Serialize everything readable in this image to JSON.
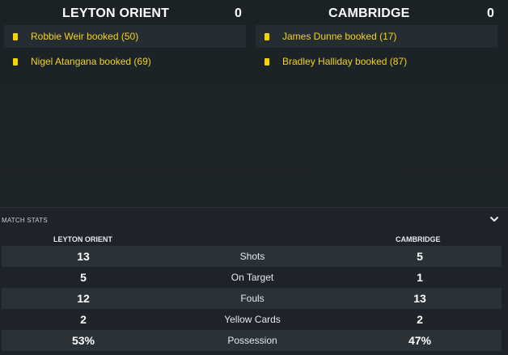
{
  "home": {
    "name": "LEYTON ORIENT",
    "score": "0",
    "events": [
      {
        "text": "Robbie Weir booked (50)"
      },
      {
        "text": "Nigel Atangana booked (69)"
      }
    ]
  },
  "away": {
    "name": "CAMBRIDGE",
    "score": "0",
    "events": [
      {
        "text": "James Dunne booked (17)"
      },
      {
        "text": "Bradley Halliday booked (87)"
      }
    ]
  },
  "match_stats": {
    "title": "MATCH STATS",
    "home_header": "LEYTON ORIENT",
    "away_header": "CAMBRIDGE",
    "rows": [
      {
        "label": "Shots",
        "home": "13",
        "away": "5"
      },
      {
        "label": "On Target",
        "home": "5",
        "away": "1"
      },
      {
        "label": "Fouls",
        "home": "12",
        "away": "13"
      },
      {
        "label": "Yellow Cards",
        "home": "2",
        "away": "2"
      },
      {
        "label": "Possession",
        "home": "53%",
        "away": "47%"
      }
    ]
  },
  "colors": {
    "background": "#1d2328",
    "event_text": "#f3d21f",
    "card_yellow": "#f5d400",
    "row_shade": "#2a3237"
  },
  "icons": {
    "card": "yellow-card-icon",
    "collapse": "chevron-down-icon"
  }
}
